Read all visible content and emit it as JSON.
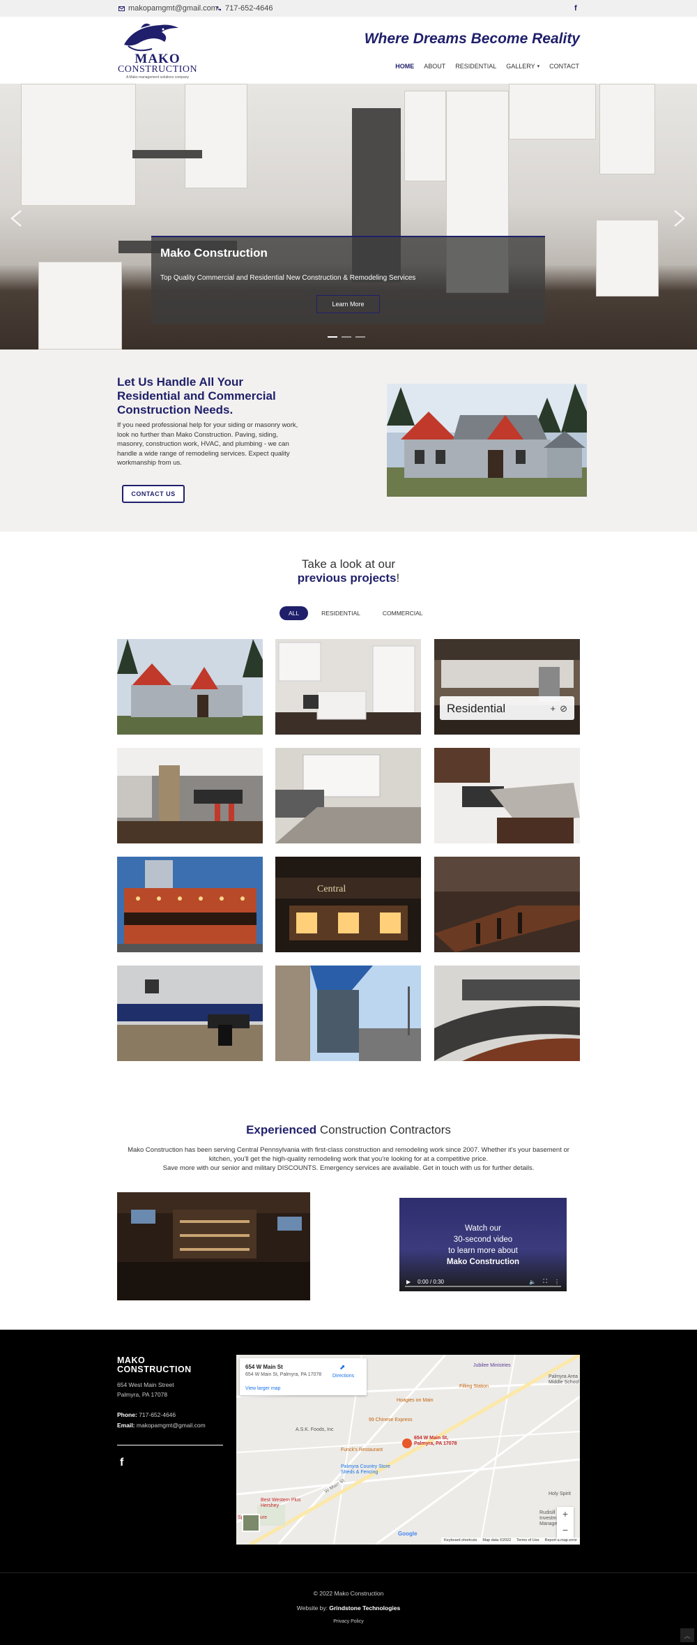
{
  "topbar": {
    "email": "makopamgmt@gmail.com",
    "phone": "717-652-4646",
    "social_icon": "facebook-icon"
  },
  "header": {
    "logo_name_1": "MAKO",
    "logo_name_2": "CONSTRUCTION",
    "logo_tag": "A Mako management solutions company",
    "tagline": "Where Dreams Become Reality",
    "nav": {
      "home": "HOME",
      "about": "ABOUT",
      "residential": "RESIDENTIAL",
      "gallery": "GALLERY",
      "contact": "CONTACT"
    }
  },
  "hero": {
    "title": "Mako Construction",
    "subtitle": "Top Quality Commercial and Residential New Construction & Remodeling Services",
    "button": "Learn More",
    "slides_count": 3,
    "active_slide": 1
  },
  "intro": {
    "heading": "Let Us Handle All Your Residential and Commercial Construction Needs.",
    "body": "If you need professional help for your siding or masonry work, look no further than Mako Construction. Paving, siding, masonry, construction work, HVAC, and plumbing - we can handle a wide range of remodeling services. Expect quality workmanship from us.",
    "button": "CONTACT US"
  },
  "projects": {
    "title_line1": "Take a look at our",
    "title_bold": "previous projects",
    "title_end": "!",
    "filters": [
      "ALL",
      "RESIDENTIAL",
      "COMMERCIAL"
    ],
    "active_filter": "ALL",
    "hover_card_label": "Residential"
  },
  "experience": {
    "title_bold": "Experienced",
    "title_rest": " Construction Contractors",
    "line1": "Mako Construction has been serving Central Pennsylvania with first-class construction and remodeling work since 2007. Whether it's your basement or kitchen, you'll get the high-quality remodeling work that you're looking for at a competitive price.",
    "line2": "Save more with our senior and military DISCOUNTS. Emergency services are available. Get in touch with us for further details.",
    "video": {
      "line1": "Watch our",
      "line2": "30-second video",
      "line3": "to learn more about",
      "line4": "Mako Construction",
      "time": "0:00 / 0:30"
    }
  },
  "footer": {
    "brand_line1": "MAKO",
    "brand_line2": "CONSTRUCTION",
    "address_line1": "654 West Main Street",
    "address_line2": "Palmyra, PA 17078",
    "phone_label": "Phone:",
    "phone": "717-652-4646",
    "email_label": "Email:",
    "email": "makopamgmt@gmail.com",
    "map": {
      "card_title": "654 W Main St",
      "card_address": "654 W Main St, Palmyra, PA 17078",
      "directions": "Directions",
      "view_larger": "View larger map",
      "pin_label": "654 W Main St, Palmyra, PA 17078",
      "places": {
        "jubilee": "Jubilee Ministries",
        "filling": "Filling Station",
        "hoagies": "Hoagies on Main",
        "chinese": "99 Chinese Express",
        "funcks": "Funck's Restaurant",
        "ask": "A.S.K. Foods, Inc",
        "country": "Palmyra Country Store Sheds & Fencing",
        "bestwestern": "Best Western Plus Hershey",
        "pedicure": "Spa Pedicure",
        "holy": "Holy Spirit",
        "rudisill": "Rudisill Investment Management",
        "palmyra_ms": "Palmyra Area Middle School",
        "street": "W Main St"
      },
      "footer_keyboard": "Keyboard shortcuts",
      "footer_data": "Map data ©2022",
      "footer_terms": "Terms of Use",
      "footer_report": "Report a map error",
      "google": "Google",
      "zoom_in": "+",
      "zoom_out": "−"
    }
  },
  "bottom": {
    "copyright": "© 2022 Mako Construction",
    "website_by_label": "Website by:",
    "website_by": "Grindstone Technologies",
    "privacy": "Privacy Policy"
  },
  "colors": {
    "brand": "#1f1f6b",
    "footer_bg": "#000000",
    "intro_bg": "#f2f1ef"
  }
}
